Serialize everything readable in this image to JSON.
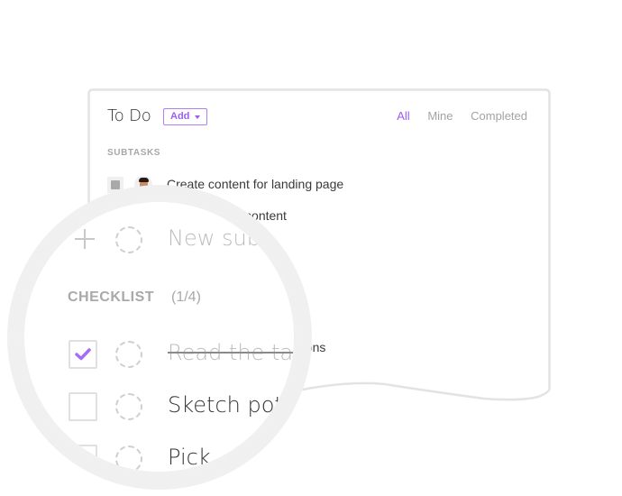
{
  "card": {
    "title": "To Do",
    "add_button": "Add",
    "filters": [
      {
        "label": "All",
        "active": true
      },
      {
        "label": "Mine",
        "active": false
      },
      {
        "label": "Completed",
        "active": false
      }
    ],
    "subtasks_label": "SUBTASKS",
    "subtasks": [
      {
        "text": "Create content for landing page",
        "status": "gray"
      },
      {
        "text": "Proofread the content",
        "visible_fragment": "d the content"
      }
    ],
    "behind_fragments": [
      "utions",
      "n"
    ]
  },
  "magnifier": {
    "new_subtask_placeholder": "New sub",
    "checklist_label": "CHECKLIST",
    "checklist_count": "(1/4)",
    "checklist": [
      {
        "text": "Read the tas",
        "checked": true
      },
      {
        "text": "Sketch pot",
        "checked": false
      },
      {
        "text": "Pick ",
        "checked": false
      }
    ]
  },
  "colors": {
    "accent": "#9b5cf6",
    "muted": "#a7a7a7",
    "border": "#e3e3e3"
  }
}
